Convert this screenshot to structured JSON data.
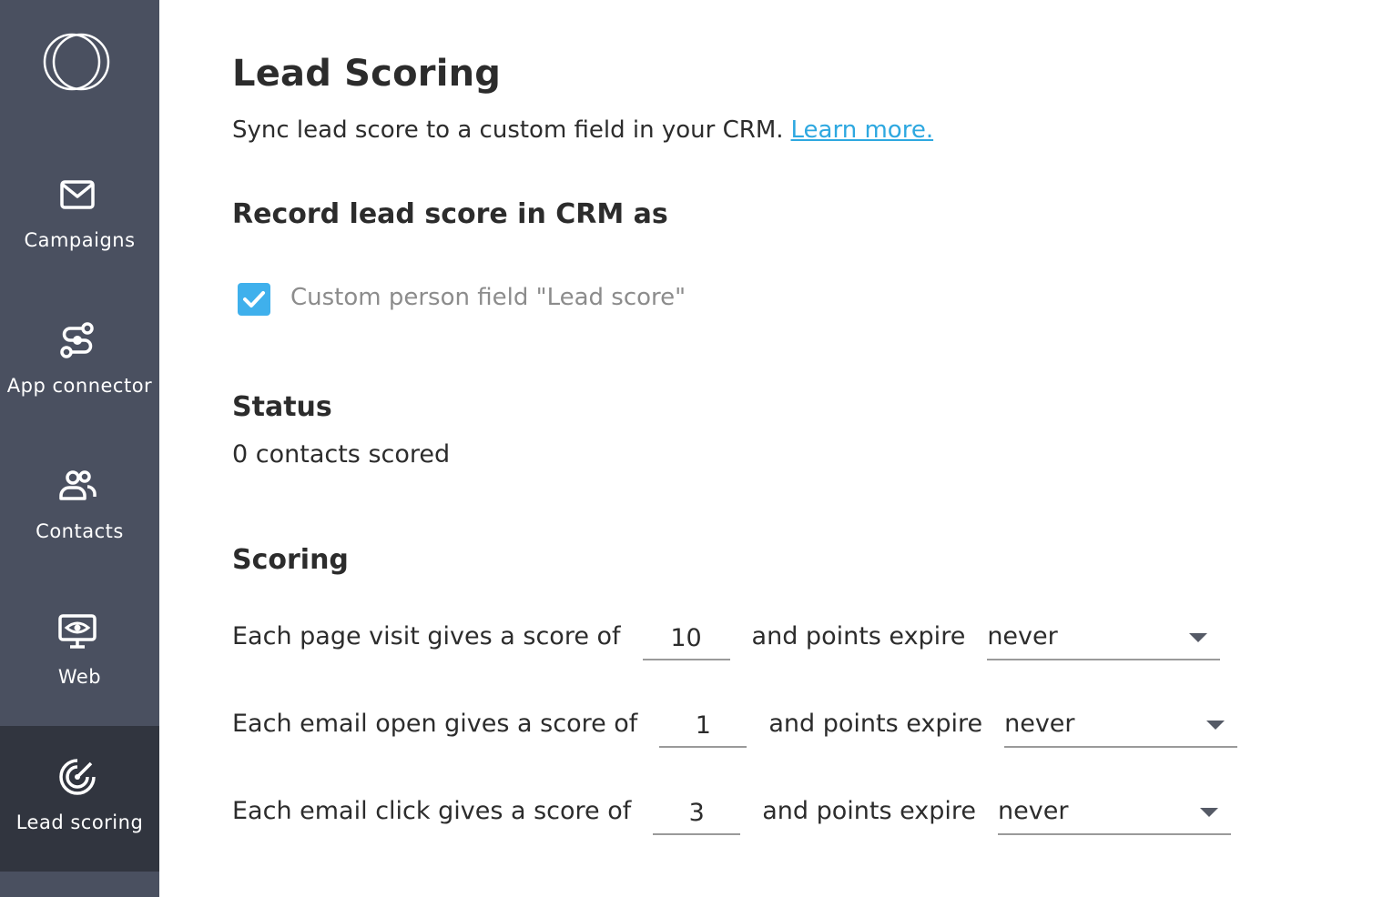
{
  "sidebar": {
    "logo_icon": "overlapping-circles-logo",
    "items": [
      {
        "label": "Campaigns",
        "icon": "envelope-icon",
        "active": false
      },
      {
        "label": "App connector",
        "icon": "connector-icon",
        "active": false
      },
      {
        "label": "Contacts",
        "icon": "users-icon",
        "active": false
      },
      {
        "label": "Web",
        "icon": "monitor-eye-icon",
        "active": false
      },
      {
        "label": "Lead scoring",
        "icon": "target-icon",
        "active": true
      }
    ]
  },
  "page": {
    "title": "Lead Scoring",
    "subtitle": "Sync lead score to a custom field in your CRM.",
    "learn_more": "Learn more."
  },
  "record": {
    "heading": "Record lead score in CRM as",
    "checkbox_label": "Custom person field \"Lead score\"",
    "checked": true
  },
  "status": {
    "heading": "Status",
    "text": "0 contacts scored"
  },
  "scoring": {
    "heading": "Scoring",
    "rows": [
      {
        "label": "Each page visit gives a score of",
        "score": "10",
        "expire_label": "and points expire",
        "expire_value": "never"
      },
      {
        "label": "Each email open gives a score of",
        "score": "1",
        "expire_label": "and points expire",
        "expire_value": "never"
      },
      {
        "label": "Each email click gives a score of",
        "score": "3",
        "expire_label": "and points expire",
        "expire_value": "never"
      }
    ]
  },
  "colors": {
    "sidebar_bg": "#4a5060",
    "sidebar_active_bg": "#31353f",
    "link": "#2ea8e0",
    "checkbox": "#3fb0ec"
  }
}
